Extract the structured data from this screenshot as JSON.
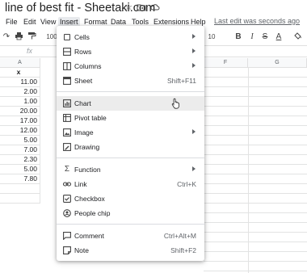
{
  "title": "line of best fit - Sheetaki.com",
  "title_icons": [
    "star-icon",
    "move-folder-icon",
    "cloud-status-icon"
  ],
  "menubar": {
    "items": [
      "File",
      "Edit",
      "View",
      "Insert",
      "Format",
      "Data",
      "Tools",
      "Extensions",
      "Help"
    ],
    "active": "Insert",
    "last_edit": "Last edit was seconds ago"
  },
  "toolbar": {
    "zoom": "100",
    "font_size": "10",
    "bold": "B",
    "italic": "I",
    "strike": "S",
    "text_color": "A"
  },
  "formula_bar": {
    "fx": "fx",
    "name_box": ""
  },
  "columns": [
    "A",
    "F",
    "G"
  ],
  "sheet": {
    "header": "x",
    "values": [
      "11.00",
      "2.00",
      "1.00",
      "20.00",
      "17.00",
      "12.00",
      "5.00",
      "7.00",
      "2.30",
      "5.00",
      "7.80"
    ]
  },
  "insert_menu": {
    "groups": [
      [
        {
          "label": "Cells",
          "icon": "cells-icon",
          "shortcut": "",
          "submenu": true
        },
        {
          "label": "Rows",
          "icon": "rows-icon",
          "shortcut": "",
          "submenu": true
        },
        {
          "label": "Columns",
          "icon": "columns-icon",
          "shortcut": "",
          "submenu": true
        },
        {
          "label": "Sheet",
          "icon": "sheet-icon",
          "shortcut": "Shift+F11",
          "submenu": false
        }
      ],
      [
        {
          "label": "Chart",
          "icon": "chart-icon",
          "shortcut": "",
          "submenu": false,
          "hover": true
        },
        {
          "label": "Pivot table",
          "icon": "pivot-table-icon",
          "shortcut": "",
          "submenu": false
        },
        {
          "label": "Image",
          "icon": "image-icon",
          "shortcut": "",
          "submenu": true
        },
        {
          "label": "Drawing",
          "icon": "drawing-icon",
          "shortcut": "",
          "submenu": false
        }
      ],
      [
        {
          "label": "Function",
          "icon": "function-sigma-icon",
          "shortcut": "",
          "submenu": true
        },
        {
          "label": "Link",
          "icon": "link-icon",
          "shortcut": "Ctrl+K",
          "submenu": false
        },
        {
          "label": "Checkbox",
          "icon": "checkbox-icon",
          "shortcut": "",
          "submenu": false
        },
        {
          "label": "People chip",
          "icon": "people-chip-icon",
          "shortcut": "",
          "submenu": false
        }
      ],
      [
        {
          "label": "Comment",
          "icon": "comment-icon",
          "shortcut": "Ctrl+Alt+M",
          "submenu": false
        },
        {
          "label": "Note",
          "icon": "note-icon",
          "shortcut": "Shift+F2",
          "submenu": false
        }
      ]
    ]
  },
  "colors": {
    "accent": "#1a73e8",
    "menu_hover": "#ececec",
    "separator": "#dadce0"
  }
}
